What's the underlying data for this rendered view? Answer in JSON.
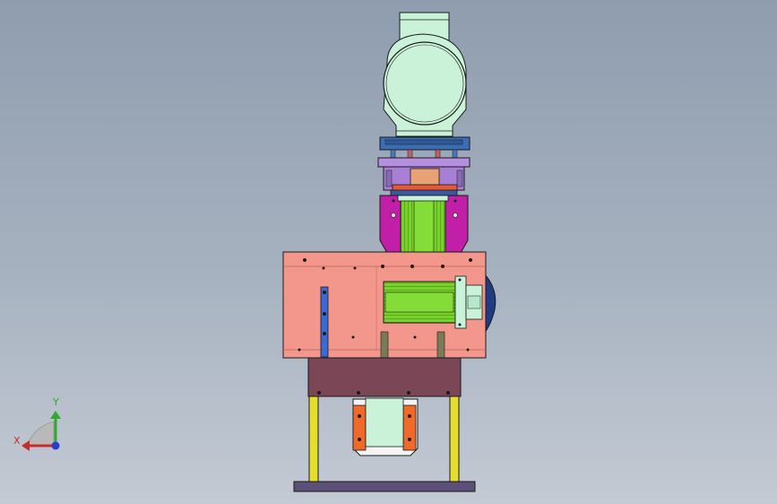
{
  "view": {
    "background_top": "#8f9dae",
    "background_bottom": "#c3cad4"
  },
  "triad": {
    "y_label": "Y",
    "x_label": "X",
    "x_color": "#cc2a2a",
    "y_color": "#2ea82e",
    "z_color": "#2a3ccc"
  },
  "colors": {
    "motor_housing": "#c9f2d8",
    "blue_plate": "#3a6db4",
    "purple_plate": "#b78fe0",
    "magenta_block": "#c21fa8",
    "green_motor": "#79d22c",
    "salmon_plate": "#f3978c",
    "maroon_block": "#7b4656",
    "yellow_leg": "#e6de2e",
    "base_plate": "#5c4f78",
    "orange_bracket": "#ef6a2a",
    "navy_disc": "#1f3b82"
  }
}
